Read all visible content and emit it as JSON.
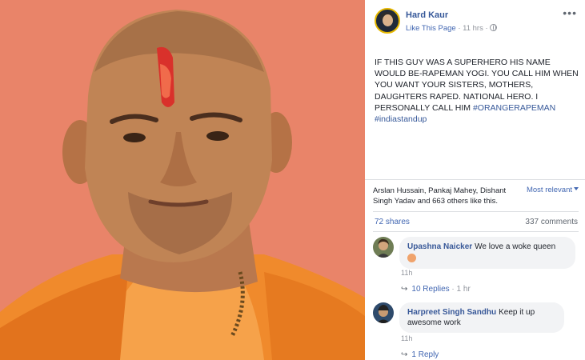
{
  "post": {
    "page_name": "Hard Kaur",
    "like_page": "Like This Page",
    "time": "11 hrs",
    "more_icon": "more-horizontal-icon",
    "text": "IF THIS GUY WAS A SUPERHERO HIS NAME WOULD BE-RAPEMAN YOGI. YOU CALL HIM WHEN YOU WANT YOUR SISTERS, MOTHERS, DAUGHTERS RAPED. NATIONAL HERO. I PERSONALLY CALL HIM ",
    "hashtag1": "#ORANGERAPEMAN",
    "hashtag2": "#indiastandup"
  },
  "reactions": {
    "names": "Arslan Hussain, Pankaj Mahey, Dishant Singh Yadav and 663 others like this.",
    "sort_label": "Most relevant",
    "shares": "72 shares",
    "comments": "337 comments"
  },
  "comments": [
    {
      "author": "Upashna Naicker",
      "text": "We love a woke queen",
      "emoji": "raised-hand-emoji",
      "time": "11h",
      "replies": "10 Replies",
      "reply_time": "1 hr"
    },
    {
      "author": "Harpreet Singh Sandhu",
      "text": "Keep it up awesome work",
      "time": "11h",
      "replies": "1 Reply"
    }
  ],
  "colors": {
    "photo_background": "#e98469",
    "robe": "#f08a2c",
    "link": "#4267b2",
    "author": "#385898"
  }
}
